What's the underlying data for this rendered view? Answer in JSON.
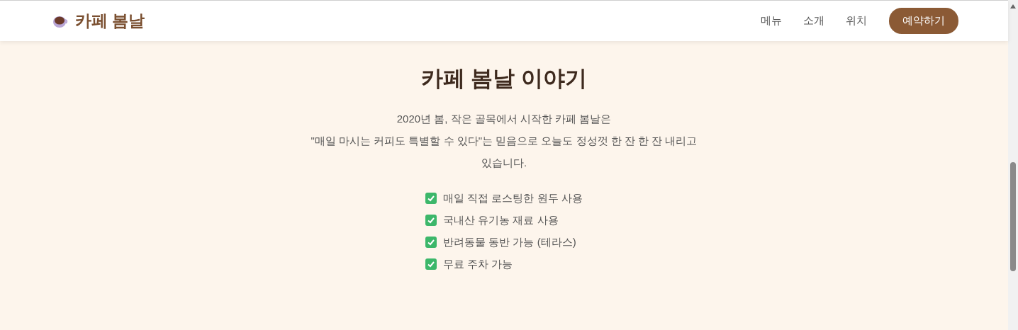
{
  "header": {
    "brand": "카페 봄날",
    "nav": [
      "메뉴",
      "소개",
      "위치"
    ],
    "cta": "예약하기"
  },
  "about": {
    "title": "카페 봄날 이야기",
    "lines": [
      "2020년 봄, 작은 골목에서 시작한 카페 봄날은",
      "\"매일 마시는 커피도 특별할 수 있다\"는 믿음으로 오늘도 정성껏 한 잔 한 잔 내리고",
      "있습니다."
    ],
    "features": [
      "매일 직접 로스팅한 원두 사용",
      "국내산 유기농 재료 사용",
      "반려동물 동반 가능 (테라스)",
      "무료 주차 가능"
    ]
  }
}
